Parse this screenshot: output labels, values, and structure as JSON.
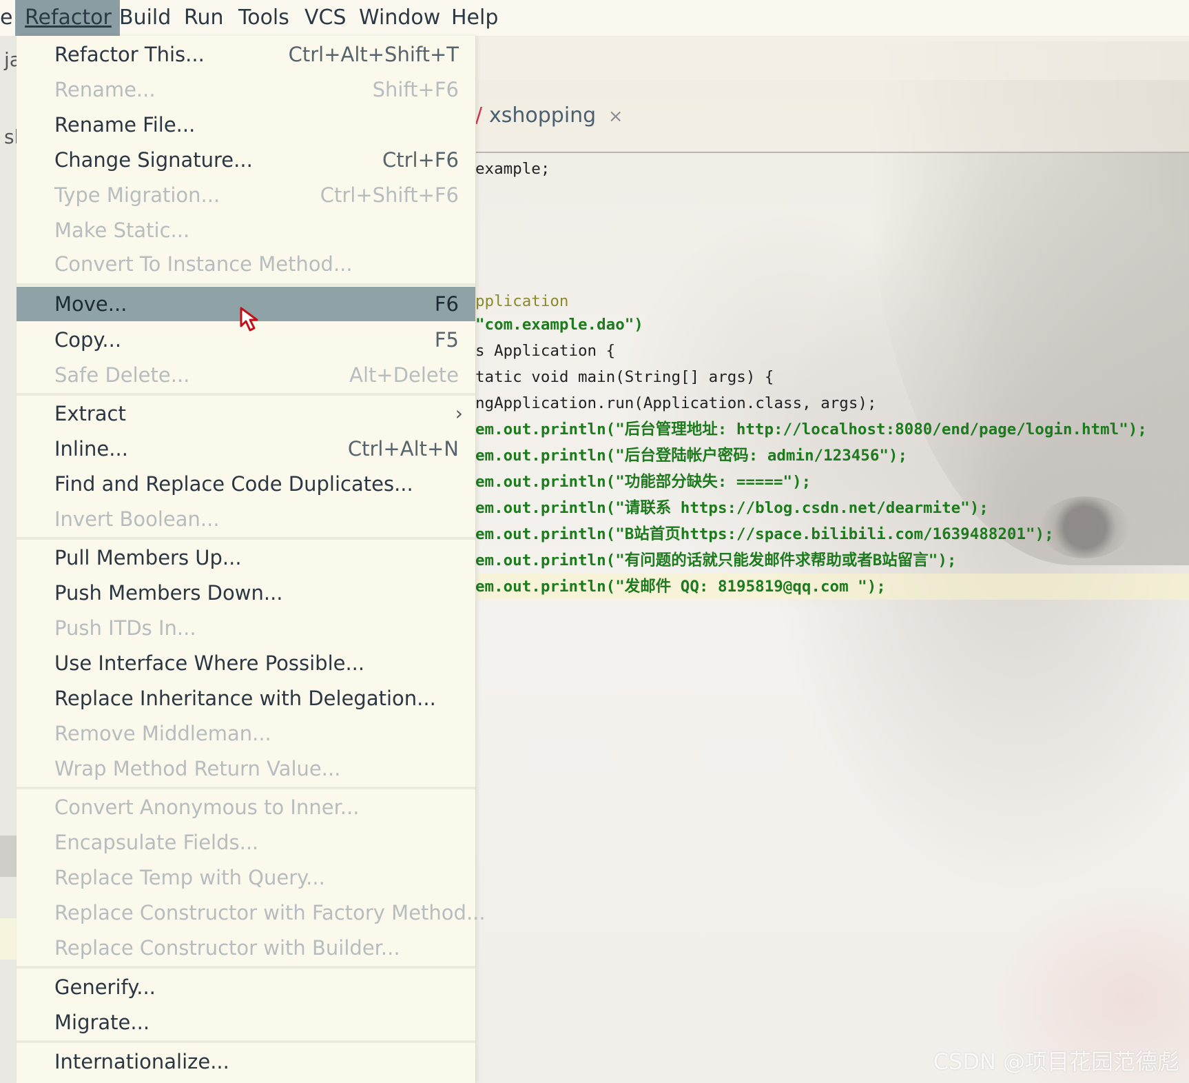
{
  "menubar": {
    "items": [
      {
        "label": "e"
      },
      {
        "label": "Refactor"
      },
      {
        "label": "Build"
      },
      {
        "label": "Run"
      },
      {
        "label": "Tools"
      },
      {
        "label": "VCS"
      },
      {
        "label": "Window"
      },
      {
        "label": "Help"
      }
    ]
  },
  "editor": {
    "tab_label": "xshopping",
    "tab_close": "×",
    "gutter_labels": [
      "ja",
      "sh"
    ]
  },
  "code_lines": [
    "example;",
    "pplication",
    "\"com.example.dao\")",
    "s Application {",
    "tatic void main(String[] args) {",
    "ngApplication.run(Application.class, args);",
    "em.out.println(\"后台管理地址: http://localhost:8080/end/page/login.html\");",
    "em.out.println(\"后台登陆帐户密码: admin/123456\");",
    "em.out.println(\"功能部分缺失: =====\");",
    "em.out.println(\"请联系 https://blog.csdn.net/dearmite\");",
    "em.out.println(\"B站首页https://space.bilibili.com/1639488201\");",
    "em.out.println(\"有问题的话就只能发邮件求帮助或者B站留言\");",
    "em.out.println(\"发邮件 QQ: 8195819@qq.com \");"
  ],
  "refactor_menu": {
    "items": [
      {
        "label": "Refactor This...",
        "shortcut": "Ctrl+Alt+Shift+T",
        "enabled": true
      },
      {
        "label": "Rename...",
        "shortcut": "Shift+F6",
        "enabled": false
      },
      {
        "label": "Rename File...",
        "shortcut": "",
        "enabled": true
      },
      {
        "label": "Change Signature...",
        "shortcut": "Ctrl+F6",
        "enabled": true
      },
      {
        "label": "Type Migration...",
        "shortcut": "Ctrl+Shift+F6",
        "enabled": false
      },
      {
        "label": "Make Static...",
        "shortcut": "",
        "enabled": false
      },
      {
        "label": "Convert To Instance Method...",
        "shortcut": "",
        "enabled": false
      },
      {
        "label": "Move...",
        "shortcut": "F6",
        "enabled": true,
        "selected": true
      },
      {
        "label": "Copy...",
        "shortcut": "F5",
        "enabled": true
      },
      {
        "label": "Safe Delete...",
        "shortcut": "Alt+Delete",
        "enabled": false
      },
      {
        "label": "Extract",
        "shortcut": "",
        "enabled": true,
        "submenu": true
      },
      {
        "label": "Inline...",
        "shortcut": "Ctrl+Alt+N",
        "enabled": true
      },
      {
        "label": "Find and Replace Code Duplicates...",
        "shortcut": "",
        "enabled": true
      },
      {
        "label": "Invert Boolean...",
        "shortcut": "",
        "enabled": false
      },
      {
        "label": "Pull Members Up...",
        "shortcut": "",
        "enabled": true
      },
      {
        "label": "Push Members Down...",
        "shortcut": "",
        "enabled": true
      },
      {
        "label": "Push ITDs In...",
        "shortcut": "",
        "enabled": false
      },
      {
        "label": "Use Interface Where Possible...",
        "shortcut": "",
        "enabled": true
      },
      {
        "label": "Replace Inheritance with Delegation...",
        "shortcut": "",
        "enabled": true
      },
      {
        "label": "Remove Middleman...",
        "shortcut": "",
        "enabled": false
      },
      {
        "label": "Wrap Method Return Value...",
        "shortcut": "",
        "enabled": false
      },
      {
        "label": "Convert Anonymous to Inner...",
        "shortcut": "",
        "enabled": false
      },
      {
        "label": "Encapsulate Fields...",
        "shortcut": "",
        "enabled": false
      },
      {
        "label": "Replace Temp with Query...",
        "shortcut": "",
        "enabled": false
      },
      {
        "label": "Replace Constructor with Factory Method...",
        "shortcut": "",
        "enabled": false
      },
      {
        "label": "Replace Constructor with Builder...",
        "shortcut": "",
        "enabled": false
      },
      {
        "label": "Generify...",
        "shortcut": "",
        "enabled": true
      },
      {
        "label": "Migrate...",
        "shortcut": "",
        "enabled": true
      },
      {
        "label": "Internationalize...",
        "shortcut": "",
        "enabled": true
      }
    ],
    "submenu_arrow": "›"
  },
  "watermark": "CSDN @项目花园范德彪",
  "colors": {
    "menu_bg": "#fbf8ec",
    "selected_bg": "#8fa3a6",
    "disabled_text": "#b7bcbf",
    "string_green": "#1d7a1d",
    "keyword_navy": "#1a237e"
  }
}
